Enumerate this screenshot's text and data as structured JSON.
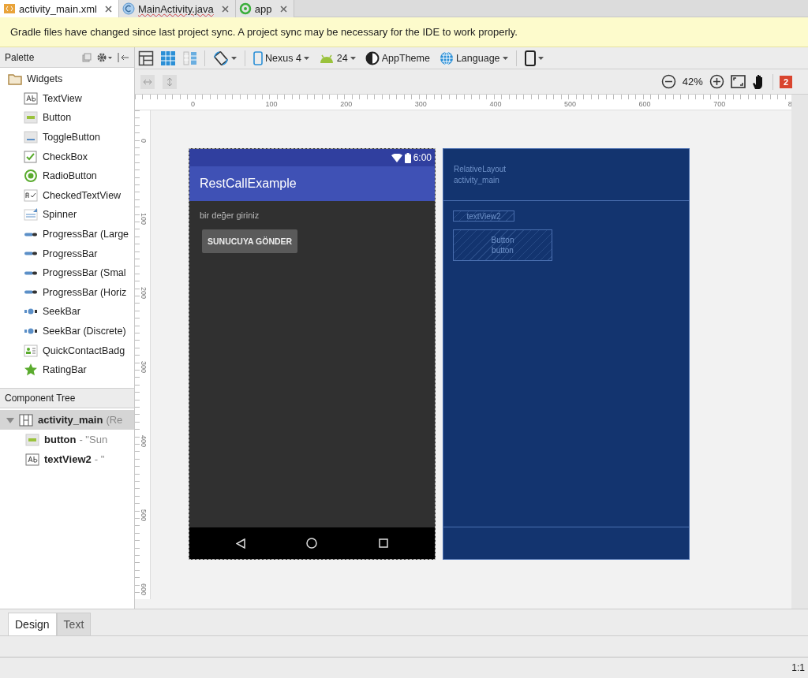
{
  "tabs": [
    {
      "label": "activity_main.xml",
      "kind": "xml",
      "selected": true
    },
    {
      "label": "MainActivity.java",
      "kind": "java",
      "selected": false
    },
    {
      "label": "app",
      "kind": "app",
      "selected": false
    }
  ],
  "notice": "Gradle files have changed since last project sync. A project sync may be necessary for the IDE to work properly.",
  "palette": {
    "title": "Palette",
    "group": "Widgets",
    "items": [
      {
        "label": "TextView",
        "kind": "text"
      },
      {
        "label": "Button",
        "kind": "button"
      },
      {
        "label": "ToggleButton",
        "kind": "toggle"
      },
      {
        "label": "CheckBox",
        "kind": "check"
      },
      {
        "label": "RadioButton",
        "kind": "radio"
      },
      {
        "label": "CheckedTextView",
        "kind": "checkedtext"
      },
      {
        "label": "Spinner",
        "kind": "spinner"
      },
      {
        "label": "ProgressBar (Large",
        "kind": "progress"
      },
      {
        "label": "ProgressBar",
        "kind": "progress"
      },
      {
        "label": "ProgressBar (Smal",
        "kind": "progress"
      },
      {
        "label": "ProgressBar (Horiz",
        "kind": "progress"
      },
      {
        "label": "SeekBar",
        "kind": "seek"
      },
      {
        "label": "SeekBar (Discrete)",
        "kind": "seek"
      },
      {
        "label": "QuickContactBadg",
        "kind": "contact"
      },
      {
        "label": "RatingBar",
        "kind": "rating"
      }
    ]
  },
  "component_tree": {
    "title": "Component Tree",
    "nodes": [
      {
        "name": "activity_main",
        "detail": "(Re",
        "kind": "layout",
        "expanded": true,
        "selected": true,
        "children": [
          {
            "name": "button",
            "detail": "- \"Sun",
            "kind": "button",
            "selected": false
          },
          {
            "name": "textView2",
            "detail": "- \"",
            "kind": "text",
            "selected": false
          }
        ]
      }
    ]
  },
  "toolbar": {
    "view_modes": [
      {
        "kind": "design",
        "selected": false
      },
      {
        "kind": "blueprint",
        "selected": true
      },
      {
        "kind": "both",
        "selected": false
      }
    ],
    "device": "Nexus 4",
    "api": "24",
    "theme": "AppTheme",
    "language": "Language"
  },
  "zoom_bar": {
    "zoom": "42%",
    "errors": "2"
  },
  "ruler": {
    "x_labels": [
      "0",
      "100",
      "200",
      "300",
      "400",
      "500",
      "600",
      "700",
      "8"
    ],
    "y_labels": [
      "0",
      "100",
      "200",
      "300",
      "400",
      "500",
      "600"
    ]
  },
  "phone": {
    "clock": "6:00",
    "app_title": "RestCallExample",
    "hint": "bir değer giriniz",
    "button": "SUNUCUYA GÖNDER"
  },
  "blueprint": {
    "layout_type": "RelativeLayout",
    "layout_id": "activity_main",
    "widgets": [
      {
        "kind": "text",
        "label": "textView2"
      },
      {
        "kind": "button",
        "label": "Button",
        "id": "button"
      }
    ]
  },
  "bottom_tabs": [
    {
      "label": "Design",
      "selected": true
    },
    {
      "label": "Text",
      "selected": false
    }
  ],
  "status_bar": {
    "position": "1:1"
  }
}
